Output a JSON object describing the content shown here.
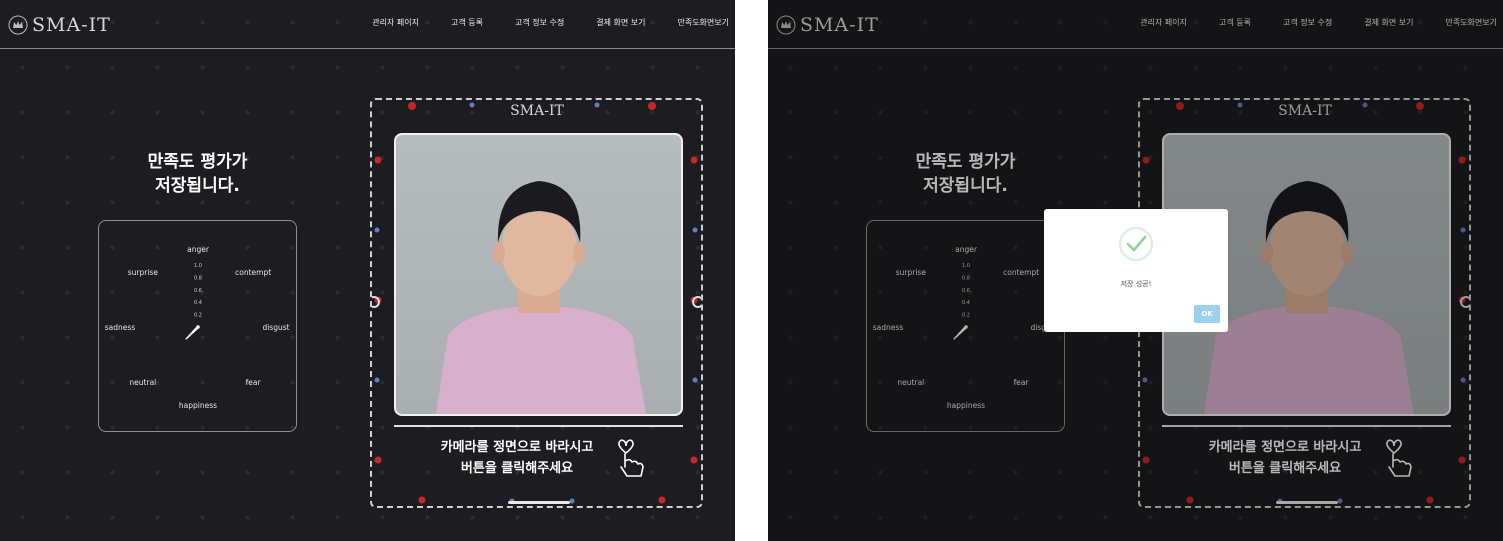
{
  "brand": {
    "name": "SMA-IT"
  },
  "nav": {
    "items": [
      "관리자 페이지",
      "고객 등록",
      "고객 정보 수정",
      "결제 화면 보기",
      "만족도화면보기"
    ]
  },
  "satisfaction": {
    "headline_line1": "만족도 평가가",
    "headline_line2": "저장됩니다."
  },
  "radar": {
    "emotions": [
      "anger",
      "contempt",
      "disgust",
      "fear",
      "happiness",
      "neutral",
      "sadness",
      "surprise"
    ],
    "scale_ticks": [
      "1.0",
      "0.8",
      "0.6",
      "0.4",
      "0.2"
    ],
    "values": [
      0.0,
      0.0,
      0.0,
      0.0,
      0.0,
      0.28,
      0.0,
      0.0
    ]
  },
  "camera": {
    "frame_title": "SMA-IT",
    "instruction_line1": "카메라를 정면으로 바라시고",
    "instruction_line2": "버튼을 클릭해주세요"
  },
  "dialog": {
    "message": "저장 성공!",
    "ok_label": "OK"
  },
  "colors": {
    "background": "#1d1c20",
    "accent_ok": "#9ad2ee",
    "success_check": "#8fd19e",
    "shirt": "#d9b0cb"
  },
  "icons": [
    "crown-icon",
    "touch-heart-icon",
    "check-icon"
  ]
}
